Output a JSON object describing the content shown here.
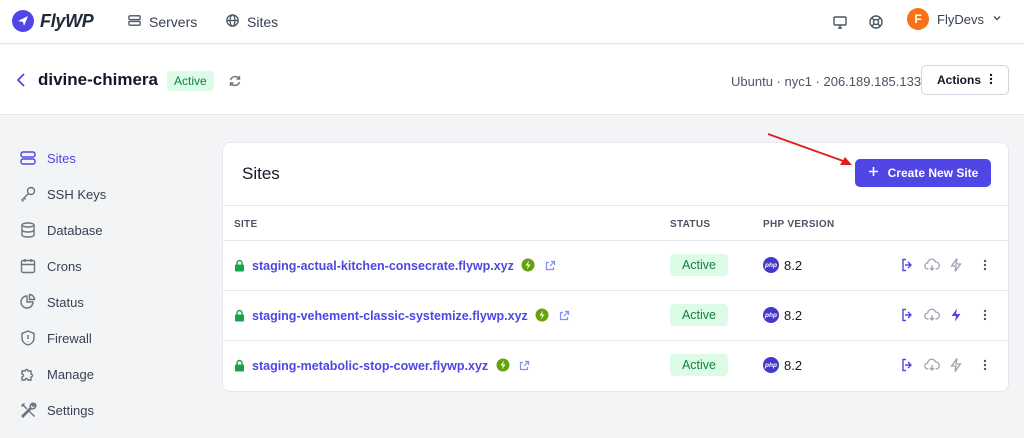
{
  "nav": {
    "logo_text": "FlyWP",
    "links": [
      {
        "label": "Servers",
        "icon": "server-icon"
      },
      {
        "label": "Sites",
        "icon": "globe-icon"
      }
    ],
    "user": {
      "initial": "F",
      "name": "FlyDevs",
      "avatar_color": "#f97316"
    }
  },
  "server": {
    "name": "divine-chimera",
    "status": "Active",
    "meta": "Ubuntu · nyc1 · 206.189.185.133",
    "actions_label": "Actions"
  },
  "sidebar": {
    "items": [
      {
        "label": "Sites",
        "icon": "sites-icon",
        "active": true
      },
      {
        "label": "SSH Keys",
        "icon": "key-icon"
      },
      {
        "label": "Database",
        "icon": "database-icon"
      },
      {
        "label": "Crons",
        "icon": "calendar-icon"
      },
      {
        "label": "Status",
        "icon": "pie-chart-icon"
      },
      {
        "label": "Firewall",
        "icon": "shield-icon"
      },
      {
        "label": "Manage",
        "icon": "puzzle-icon"
      },
      {
        "label": "Settings",
        "icon": "tools-icon"
      }
    ]
  },
  "sites_card": {
    "title": "Sites",
    "create_label": "Create New Site",
    "columns": {
      "site": "SITE",
      "status": "STATUS",
      "php": "PHP VERSION"
    },
    "rows": [
      {
        "domain": "staging-actual-kitchen-consecrate.flywp.xyz",
        "status": "Active",
        "php_version": "8.2",
        "php_logo": "php",
        "cache_active": false
      },
      {
        "domain": "staging-vehement-classic-systemize.flywp.xyz",
        "status": "Active",
        "php_version": "8.2",
        "php_logo": "php",
        "cache_active": true
      },
      {
        "domain": "staging-metabolic-stop-cower.flywp.xyz",
        "status": "Active",
        "php_version": "8.2",
        "php_logo": "php",
        "cache_active": false
      }
    ]
  },
  "colors": {
    "accent": "#4f46e5",
    "active_bg": "#dcfce7",
    "active_text": "#15803d",
    "annotation": "#e11d1d"
  }
}
